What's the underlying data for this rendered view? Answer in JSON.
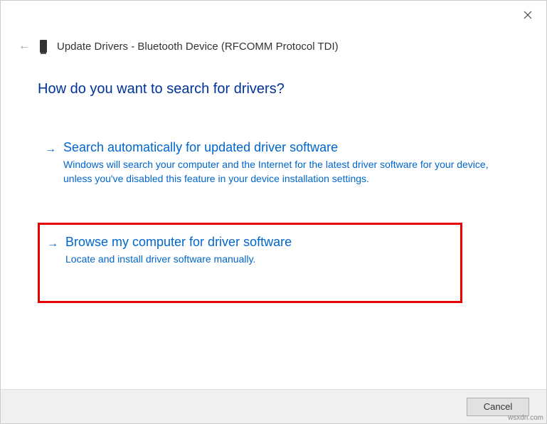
{
  "header": {
    "title": "Update Drivers - Bluetooth Device (RFCOMM Protocol TDI)"
  },
  "main": {
    "heading": "How do you want to search for drivers?"
  },
  "options": {
    "auto": {
      "title": "Search automatically for updated driver software",
      "description": "Windows will search your computer and the Internet for the latest driver software for your device, unless you've disabled this feature in your device installation settings."
    },
    "browse": {
      "title": "Browse my computer for driver software",
      "description": "Locate and install driver software manually."
    }
  },
  "buttons": {
    "cancel": "Cancel"
  },
  "watermark": "wsxdn.com"
}
